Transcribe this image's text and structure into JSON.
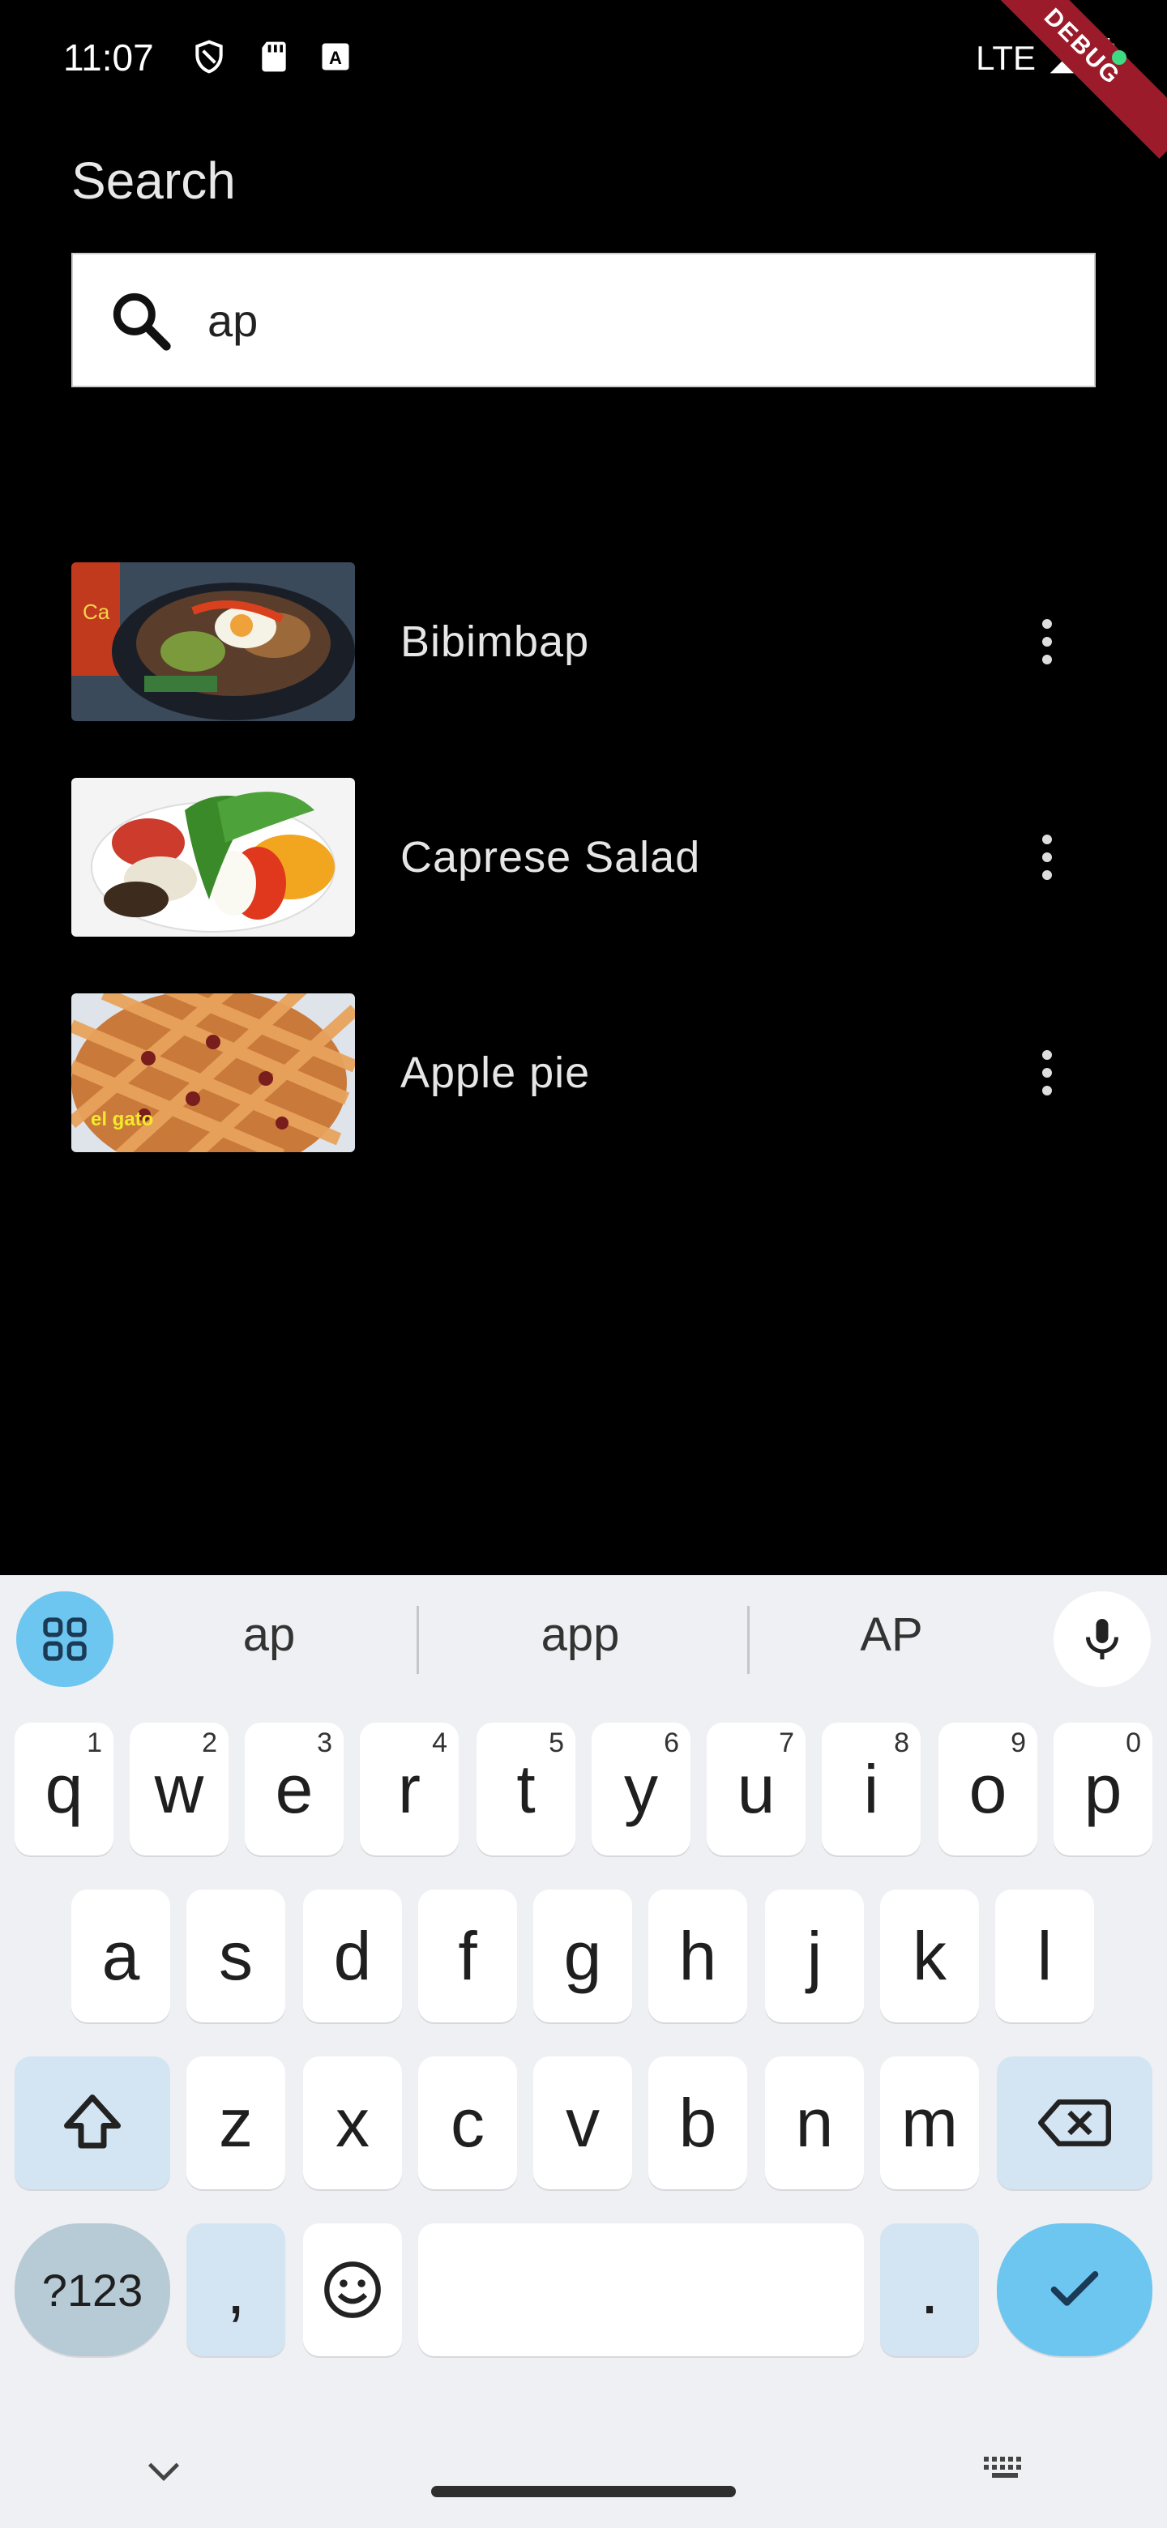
{
  "status_bar": {
    "time": "11:07",
    "network": "LTE",
    "debug_label": "DEBUG"
  },
  "page": {
    "title": "Search"
  },
  "search": {
    "value": "ap"
  },
  "results": [
    {
      "name": "Bibimbap"
    },
    {
      "name": "Caprese Salad"
    },
    {
      "name": "Apple pie"
    }
  ],
  "thumbnails": {
    "apple_pie_caption": "el gato"
  },
  "keyboard": {
    "suggestions": [
      "ap",
      "app",
      "AP"
    ],
    "row1": [
      {
        "key": "q",
        "hint": "1"
      },
      {
        "key": "w",
        "hint": "2"
      },
      {
        "key": "e",
        "hint": "3"
      },
      {
        "key": "r",
        "hint": "4"
      },
      {
        "key": "t",
        "hint": "5"
      },
      {
        "key": "y",
        "hint": "6"
      },
      {
        "key": "u",
        "hint": "7"
      },
      {
        "key": "i",
        "hint": "8"
      },
      {
        "key": "o",
        "hint": "9"
      },
      {
        "key": "p",
        "hint": "0"
      }
    ],
    "row2": [
      "a",
      "s",
      "d",
      "f",
      "g",
      "h",
      "j",
      "k",
      "l"
    ],
    "row3": [
      "z",
      "x",
      "c",
      "v",
      "b",
      "n",
      "m"
    ],
    "mode_key": "?123",
    "comma": ",",
    "period": "."
  },
  "colors": {
    "background": "#000000",
    "keyboard_bg": "#eff0f3",
    "accent": "#6cc6f0",
    "special_key": "#d3e4f3"
  }
}
